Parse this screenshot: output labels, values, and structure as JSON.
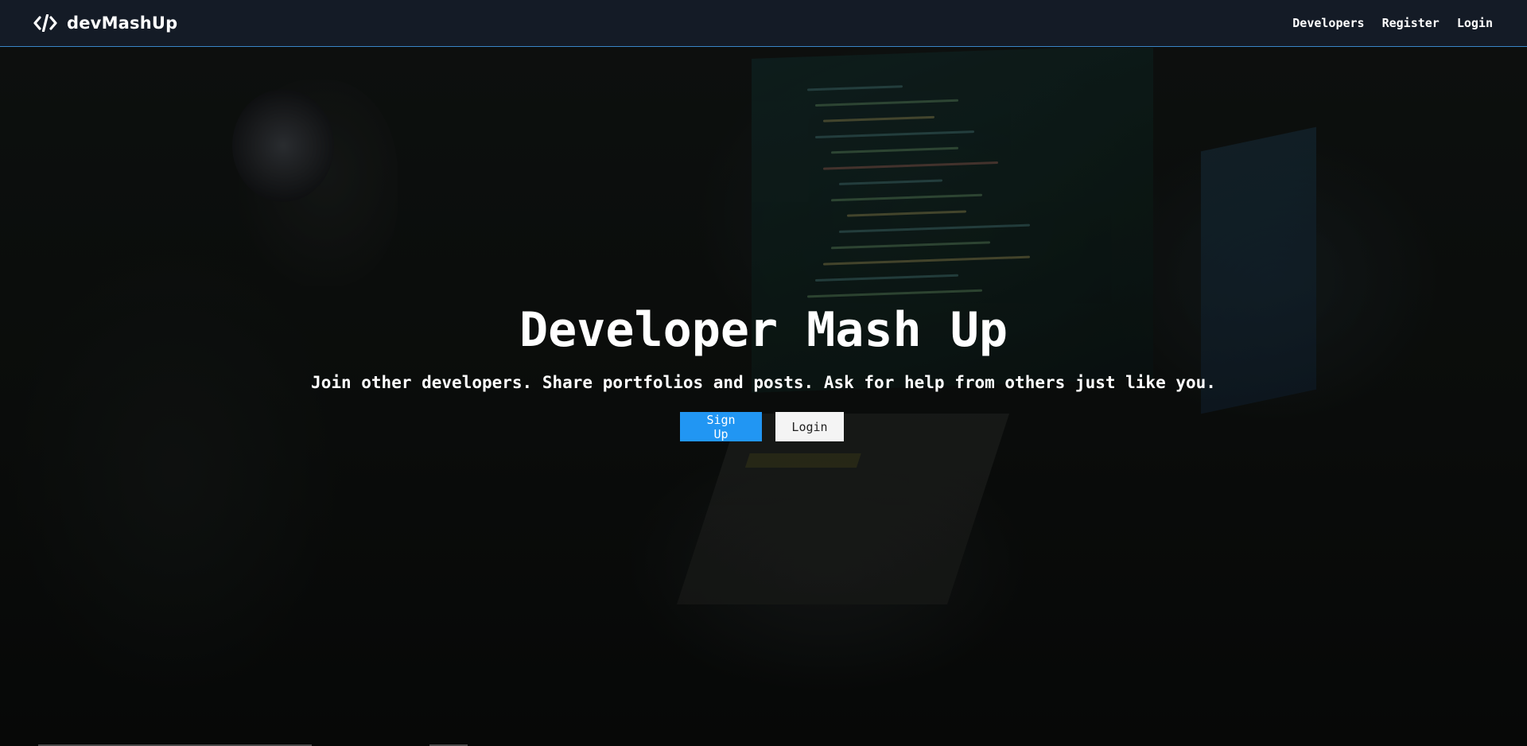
{
  "navbar": {
    "brand": "devMashUp",
    "brand_icon": "code-icon",
    "links": [
      {
        "label": "Developers"
      },
      {
        "label": "Register"
      },
      {
        "label": "Login"
      }
    ]
  },
  "hero": {
    "title": "Developer Mash Up",
    "lead": "Join other developers. Share portfolios and posts. Ask for help from others just like you.",
    "signup_label": "Sign Up",
    "login_label": "Login"
  },
  "colors": {
    "navbar_bg": "#141b26",
    "navbar_border": "#3a86c8",
    "primary": "#2196f3",
    "light": "#f4f4f4"
  }
}
